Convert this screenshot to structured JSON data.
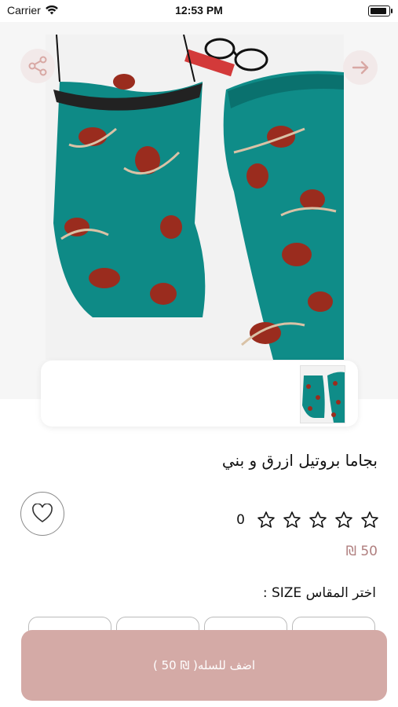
{
  "status_bar": {
    "carrier": "Carrier",
    "time": "12:53 PM"
  },
  "product": {
    "title": "بجاما بروتيل ازرق و بني",
    "rating_count": "0",
    "rating_value": 0,
    "price": "₪ 50"
  },
  "size": {
    "label": "اختر المقاس SIZE :"
  },
  "cart": {
    "add_label": "اضف للسله( ₪ 50 )"
  },
  "colors": {
    "accent": "#d4aaa6",
    "price": "#b07f7f",
    "fabric": "#0e8a86"
  },
  "icons": {
    "share": "share-icon",
    "next": "arrow-right-icon",
    "favorite": "heart-icon",
    "star": "star-outline-icon"
  }
}
